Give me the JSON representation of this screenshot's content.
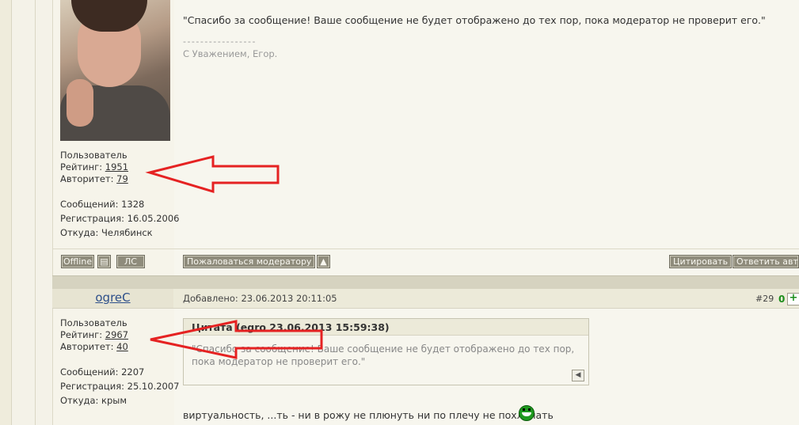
{
  "post1": {
    "quote_text": "\"Спасибо за сообщение! Ваше сообщение не будет отображено до тех пор, пока модератор не проверит его.\"",
    "sig_dashes": "- - - - - - - - - - - - - - - - -",
    "signature": "С Уважением, Егор.",
    "role": "Пользователь",
    "rating_label": "Рейтинг:",
    "rating": "1951",
    "authority_label": "Авторитет:",
    "authority": "79",
    "messages": "Сообщений: 1328",
    "registered": "Регистрация: 16.05.2006",
    "location": "Откуда: Челябинск",
    "status_button": "Offline",
    "pm_button": "ЛС",
    "report_button": "Пожаловаться модератору",
    "quote_button": "Цитировать",
    "reply_button": "Ответить авто"
  },
  "post2": {
    "author": "ogreC",
    "added": "Добавлено: 23.06.2013 20:11:05",
    "post_number": "#29",
    "votes": "0",
    "plus": "+",
    "role": "Пользователь",
    "rating_label": "Рейтинг:",
    "rating": "2967",
    "authority_label": "Авторитет:",
    "authority": "40",
    "messages": "Сообщений: 2207",
    "registered": "Регистрация: 25.10.2007",
    "location": "Откуда: крым",
    "quote_header": "Цитата (egro 23.06.2013 15:59:38)",
    "quote_text": "\"Спасибо за сообщение! Ваше сообщение не будет отображено до тех пор, пока модератор не проверит его.\"",
    "message": "виртуальность, ...ть - ни в рожу не плюнуть ни по плечу не похлопать"
  },
  "colors": {
    "arrow": "#e52222",
    "accent_green": "#1b8d1b",
    "button_bg": "#8f8c7c"
  },
  "icons": {
    "scroll_up": "up-arrow-icon",
    "profile": "profile-card-icon",
    "quote_return": "left-arrow-icon",
    "smiley": "grin-smiley-icon"
  }
}
